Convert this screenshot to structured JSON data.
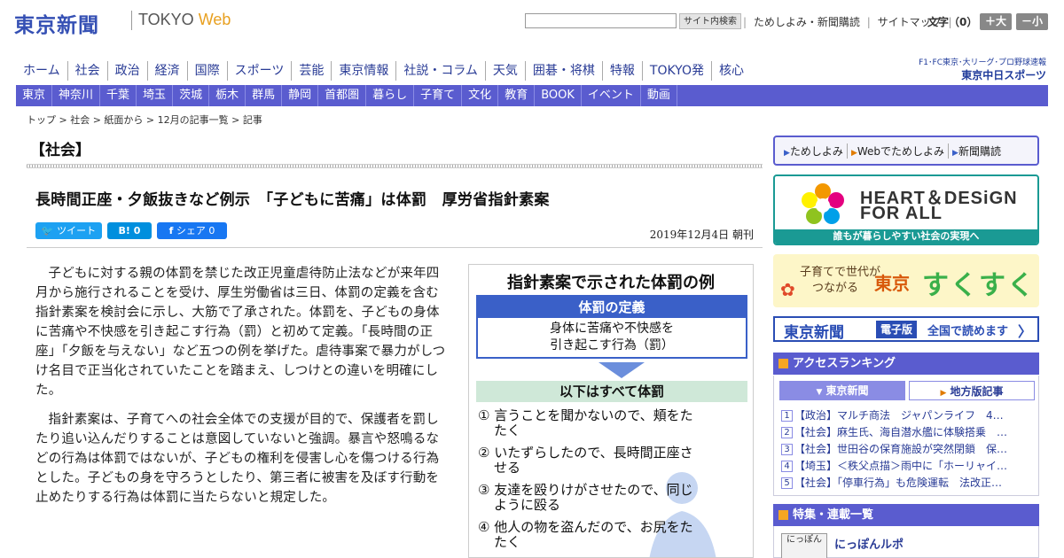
{
  "header": {
    "logo": "東京新聞",
    "logo_sub": "TOKYO",
    "logo_sub_web": "Web",
    "search_button": "サイト内検索",
    "links": [
      "ためしよみ・新聞購読",
      "サイトマップ"
    ],
    "fontsize_label": "文字（0）",
    "font_larger": "＋大",
    "font_smaller": "－小"
  },
  "main_nav": [
    "ホーム",
    "社会",
    "政治",
    "経済",
    "国際",
    "スポーツ",
    "芸能",
    "東京情報",
    "社説・コラム",
    "天気",
    "囲碁・将棋",
    "特報",
    "TOKYO発",
    "核心"
  ],
  "chunichi": {
    "small": "F1･FC東京･大リーグ･プロ野球速報",
    "big": "東京中日スポーツ"
  },
  "sub_nav": [
    "東京",
    "神奈川",
    "千葉",
    "埼玉",
    "茨城",
    "栃木",
    "群馬",
    "静岡",
    "首都圏",
    "暮らし",
    "子育て",
    "文化",
    "教育",
    "BOOK",
    "イベント",
    "動画"
  ],
  "breadcrumb": "トップ > 社会 > 紙面から > 12月の記事一覧 > 記事",
  "article": {
    "section": "【社会】",
    "headline": "長時間正座・夕飯抜きなど例示　「子どもに苦痛」は体罰　厚労省指針素案",
    "share_tweet": "ツイート",
    "share_hatena": "B! 0",
    "share_facebook": "シェア 0",
    "date": "2019年12月4日 朝刊",
    "paragraphs": [
      "子どもに対する親の体罰を禁じた改正児童虐待防止法などが来年四月から施行されることを受け、厚生労働省は三日、体罰の定義を含む指針素案を検討会に示し、大筋で了承された。体罰を、子どもの身体に苦痛や不快感を引き起こす行為（罰）と初めて定義。「長時間の正座」「夕飯を与えない」など五つの例を挙げた。虐待事案で暴力がしつけ名目で正当化されていたことを踏まえ、しつけとの違いを明確にした。",
      "指針素案は、子育てへの社会全体での支援が目的で、保護者を罰したり追い込んだりすることは意図していないと強調。暴言や怒鳴るなどの行為は体罰ではないが、子どもの権利を侵害し心を傷つける行為とした。子どもの身を守ろうとしたり、第三者に被害を及ぼす行動を止めたりする行為は体罰に当たらないと規定した。"
    ]
  },
  "graphic": {
    "title": "指針素案で示された体罰の例",
    "def_head": "体罰の定義",
    "def_line1": "身体に苦痛や不快感を",
    "def_line2": "引き起こす行為（罰）",
    "all_head": "以下はすべて体罰",
    "examples": [
      {
        "l1": "① 言うことを聞かないので、頬をた",
        "l2": "たく"
      },
      {
        "l1": "② いたずらしたので、長時間正座さ",
        "l2": "せる"
      },
      {
        "l1": "③ 友達を殴りけがさせたので、同じ",
        "l2": "ように殴る"
      },
      {
        "l1": "④ 他人の物を盗んだので、お尻をた",
        "l2": "たく"
      }
    ]
  },
  "sidebar": {
    "tame_bar": [
      "ためしよみ",
      "Webでためしよみ",
      "新聞購読"
    ],
    "heart_line1": "HEART＆DESiGN",
    "heart_line2": "FOR ALL",
    "heart_foot": "誰もが暮らしやすい社会の実現へ",
    "suku_l1": "子育てで世代が",
    "suku_l2": "つながる",
    "suku_tokyo": "東京",
    "suku_main": "すくすく",
    "denshi_logo": "東京新聞",
    "denshi_badge": "電子版",
    "denshi_text": "全国で読めます",
    "denshi_arrow": "〉",
    "ranking_title": "アクセスランキング",
    "ranking_tab_on": "東京新聞",
    "ranking_tab_off": "地方版記事",
    "ranking": [
      "【政治】マルチ商法　ジャパンライフ　4…",
      "【社会】麻生氏、海自潜水艦に体験搭乗　…",
      "【社会】世田谷の保育施設が突然閉鎖　保…",
      "【埼玉】＜秩父点描＞雨中に「ホーリャイ…",
      "【社会】「停車行為」も危険運転　法改正…"
    ],
    "toku_title": "特集・連載一覧",
    "toku_thumb": "にっぽん",
    "toku_item": "にっぽんルポ"
  },
  "colors": {
    "brand_blue": "#3550b4",
    "nav_purple": "#5a5ccf",
    "teal": "#1a9a94",
    "accent_orange": "#f6a623"
  }
}
